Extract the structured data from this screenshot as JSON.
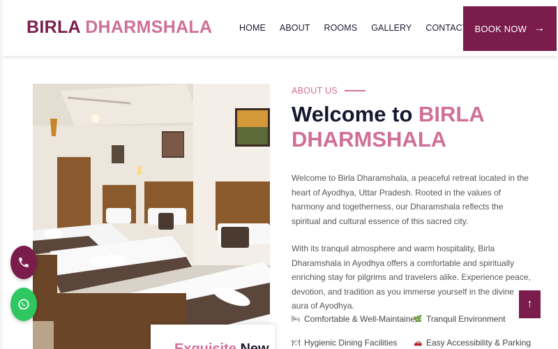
{
  "header": {
    "logo_part1": "BIRLA",
    "logo_part2": "DHARMSHALA",
    "nav": [
      "HOME",
      "ABOUT",
      "ROOMS",
      "GALLERY",
      "CONTACT US"
    ],
    "book_label": "BOOK NOW"
  },
  "about": {
    "label": "ABOUT US",
    "heading_plain": "Welcome to",
    "heading_line1_pink": "BIRLA",
    "heading_line2_pink": "DHARMSHALA",
    "paragraph1": "Welcome to Birla Dharamshala, a peaceful retreat located in the heart of Ayodhya, Uttar Pradesh. Rooted in the values of harmony and togetherness, our Dharamshala reflects the spiritual and cultural essence of this sacred city.",
    "paragraph2": "With its tranquil atmosphere and warm hospitality, Birla Dharamshala in Ayodhya offers a comfortable and spiritually enriching stay for pilgrims and travelers alike. Experience peace, devotion, and tradition as you immerse yourself in the divine aura of Ayodhya.",
    "features": [
      {
        "icon": "bed-icon",
        "label": "Comfortable & Well-Maintained"
      },
      {
        "icon": "leaf-icon",
        "label": "Tranquil Environment"
      },
      {
        "icon": "dining-icon",
        "label": "Hygienic Dining Facilities"
      },
      {
        "icon": "car-icon",
        "label": "Easy Accessibility & Parking"
      }
    ]
  },
  "photo_caption": {
    "pink": "Exquisite",
    "dark": "New"
  },
  "colors": {
    "brand_maroon": "#7a1d4d",
    "brand_pink": "#cf6f97",
    "heading_dark": "#14172e",
    "whatsapp_green": "#2fc760"
  }
}
